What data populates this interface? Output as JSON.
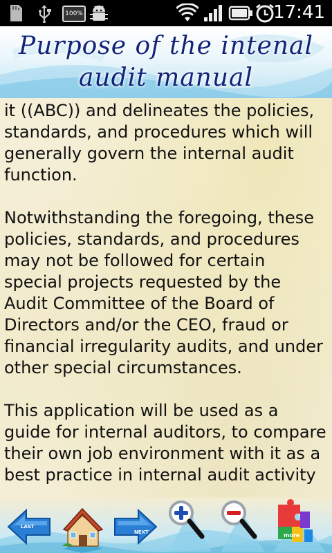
{
  "status_bar": {
    "battery_percent": "100%",
    "time": "17:41",
    "icons": [
      "sd-card-icon",
      "usb-icon",
      "battery-100-icon",
      "android-debug-icon",
      "wifi-icon",
      "signal-icon",
      "battery-icon",
      "alarm-icon"
    ]
  },
  "header": {
    "title_line1": "Purpose of the intenal",
    "title_line2": "audit manual"
  },
  "content": {
    "paragraphs": [
      "function at a mock company , we call it ((ABC)) and delineates the policies, standards, and procedures which will generally govern the internal audit function.",
      "Notwithstanding the foregoing, these policies, standards, and procedures may not be followed for certain special projects requested by the Audit Committee of the Board of Directors and/or the CEO, fraud or financial irregularity audits, and under other special circumstances.",
      "This application will be used as a guide for internal auditors, to compare their own job environment with it as a best practice in internal audit activity"
    ]
  },
  "toolbar": {
    "last_label": "LAST",
    "next_label": "NEXT",
    "more_label": "more",
    "colors": {
      "arrow": "#2a7fd4",
      "zoom_in": "#1d4fb8",
      "zoom_out": "#d42020",
      "water": "#8fd0ea"
    }
  }
}
